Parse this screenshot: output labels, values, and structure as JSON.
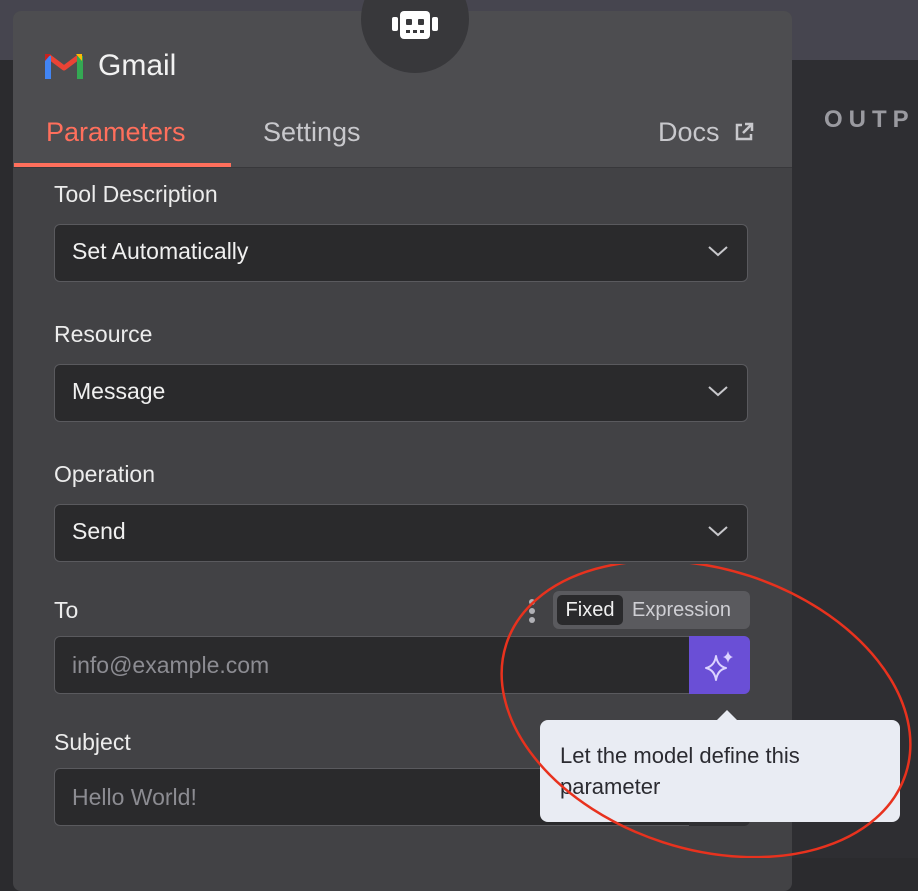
{
  "app": {
    "title": "Gmail"
  },
  "tabs": {
    "parameters": "Parameters",
    "settings": "Settings",
    "docs": "Docs"
  },
  "output_panel": {
    "label": "OUTP"
  },
  "fields": {
    "tool_description": {
      "label": "Tool Description",
      "value": "Set Automatically"
    },
    "resource": {
      "label": "Resource",
      "value": "Message"
    },
    "operation": {
      "label": "Operation",
      "value": "Send"
    },
    "to": {
      "label": "To",
      "placeholder": "info@example.com"
    },
    "subject": {
      "label": "Subject",
      "placeholder": "Hello World!"
    }
  },
  "mode_toggle": {
    "fixed": "Fixed",
    "expression": "Expression",
    "selected": "Fixed"
  },
  "tooltip": {
    "text": "Let the model define this parameter"
  },
  "colors": {
    "accent": "#ff6f5c",
    "ai_button": "#6a4fd6",
    "annotation": "#e8321e"
  },
  "icons": [
    "robot-icon",
    "gmail-logo",
    "external-link-icon",
    "chevron-down-icon",
    "more-vertical-icon",
    "sparkles-icon"
  ]
}
